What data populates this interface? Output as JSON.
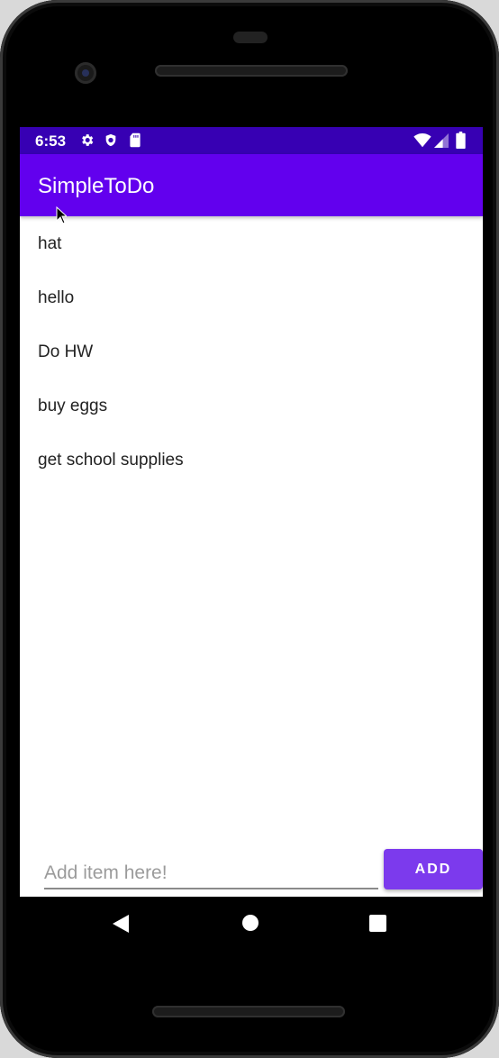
{
  "status_bar": {
    "time": "6:53",
    "left_icons": [
      "gear-icon",
      "shield-icon",
      "sd-card-icon"
    ],
    "right_icons": [
      "wifi-icon",
      "signal-icon",
      "battery-icon"
    ],
    "color": "#3700b3"
  },
  "app_bar": {
    "title": "SimpleToDo",
    "color": "#6200ee"
  },
  "todo_items": [
    "hat",
    "hello",
    "Do HW",
    "buy eggs",
    "get school supplies"
  ],
  "add_form": {
    "input_placeholder": "Add item here!",
    "input_value": "",
    "button_label": "ADD",
    "button_color": "#7c3aed"
  },
  "nav_bar": {
    "buttons": [
      "back-icon",
      "home-icon",
      "recents-icon"
    ]
  }
}
